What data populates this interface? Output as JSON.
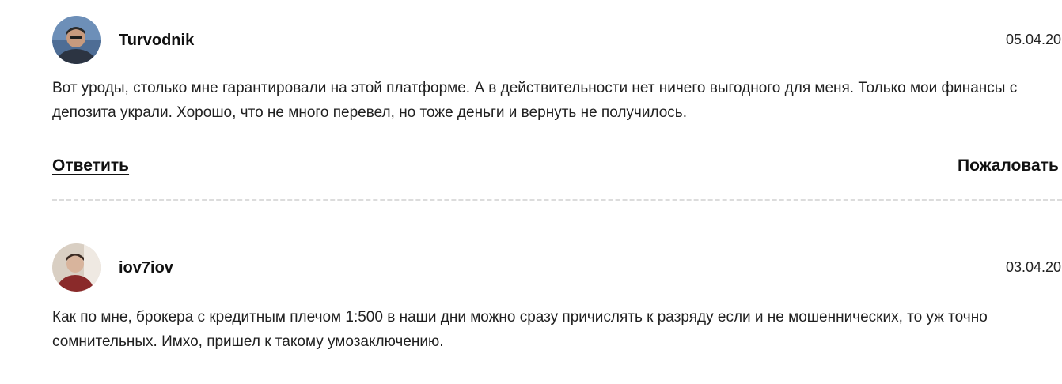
{
  "comments": [
    {
      "author": "Turvodnik",
      "date": "05.04.20",
      "text": "Вот уроды, столько мне гарантировали на этой платформе. А в действительности нет ничего выгодного для меня. Только мои финансы с депозита украли. Хорошо, что не много перевел, но тоже деньги и вернуть не получилось.",
      "reply_label": "Ответить",
      "report_label": "Пожаловать"
    },
    {
      "author": "iov7iov",
      "date": "03.04.20",
      "text": "Как по мне, брокера с кредитным плечом 1:500 в наши дни можно сразу причислять к разряду если и не мошеннических, то уж точно сомнительных. Имхо, пришел к такому умозаключению."
    }
  ]
}
